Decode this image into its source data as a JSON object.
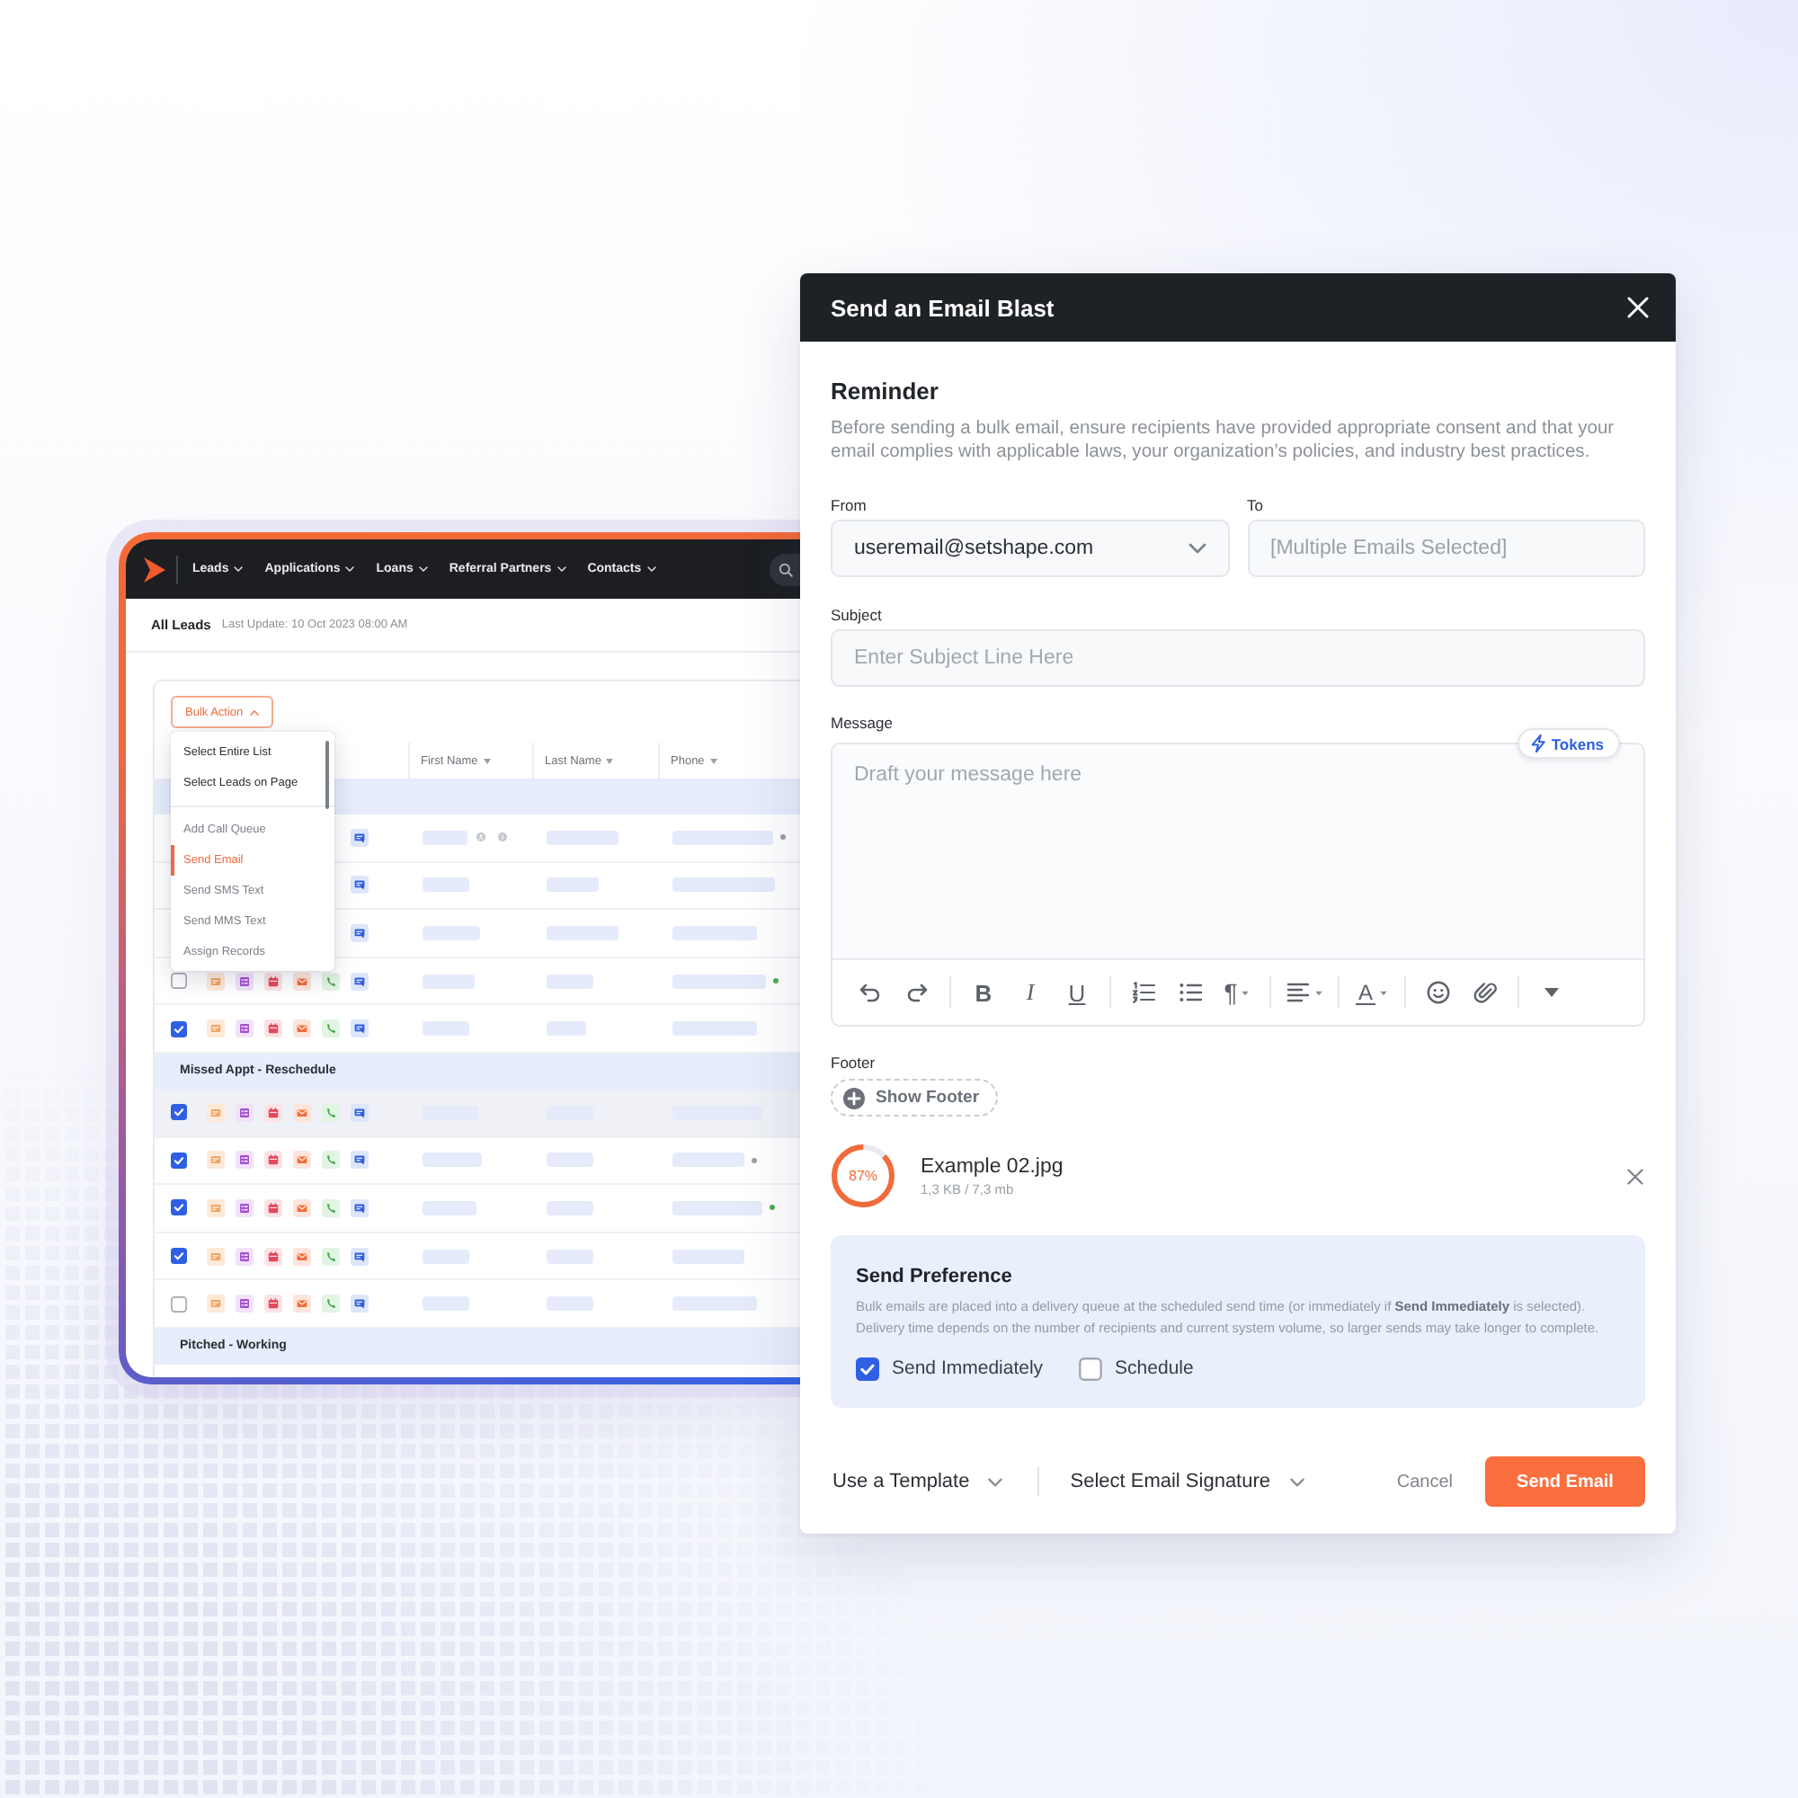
{
  "app": {
    "nav": {
      "items": [
        {
          "label": "Leads"
        },
        {
          "label": "Applications"
        },
        {
          "label": "Loans"
        },
        {
          "label": "Referral Partners"
        },
        {
          "label": "Contacts"
        }
      ]
    },
    "header": {
      "title": "All Leads",
      "last_update": "Last Update: 10 Oct 2023 08:00 AM"
    },
    "bulk_action": {
      "label": "Bulk Action",
      "expanded": true
    },
    "menu": {
      "sections": [
        {
          "kind": "selection",
          "items": [
            {
              "label": "Select Entire List",
              "selected": false
            },
            {
              "label": "Select Leads on Page",
              "selected": false
            }
          ]
        },
        {
          "kind": "action",
          "items": [
            {
              "label": "Add Call Queue",
              "selected": false
            },
            {
              "label": "Send Email",
              "selected": true
            },
            {
              "label": "Send SMS Text",
              "selected": false
            },
            {
              "label": "Send MMS Text",
              "selected": false
            },
            {
              "label": "Assign Records",
              "selected": false
            }
          ]
        }
      ]
    },
    "table": {
      "columns": [
        {
          "label": "First Name"
        },
        {
          "label": "Last Name"
        },
        {
          "label": "Phone"
        }
      ],
      "groups": [
        {
          "rows": [
            {
              "highlighted": false,
              "actions": [
                {
                  "kind": "chat"
                }
              ],
              "indicators": [
                {
                  "kind": "user"
                },
                {
                  "kind": "info"
                }
              ],
              "color": "#9aa0a6"
            },
            {
              "highlighted": false,
              "actions": [
                {
                  "kind": "chat"
                }
              ]
            },
            {
              "highlighted": false,
              "actions": [
                {
                  "kind": "chat"
                }
              ]
            },
            {
              "highlighted": false,
              "checked": false,
              "actions": [
                {
                  "kind": "note"
                },
                {
                  "kind": "list"
                },
                {
                  "kind": "calendar"
                },
                {
                  "kind": "mail"
                },
                {
                  "kind": "phone"
                },
                {
                  "kind": "chat"
                }
              ],
              "color": "#4caf50"
            },
            {
              "highlighted": false,
              "checked": true,
              "actions": [
                {
                  "kind": "note"
                },
                {
                  "kind": "list"
                },
                {
                  "kind": "calendar"
                },
                {
                  "kind": "mail"
                },
                {
                  "kind": "phone"
                },
                {
                  "kind": "chat"
                }
              ]
            }
          ]
        },
        {
          "label": "Missed Appt - Reschedule",
          "rows": [
            {
              "highlighted": true,
              "checked": true,
              "actions": [
                {
                  "kind": "note"
                },
                {
                  "kind": "list"
                },
                {
                  "kind": "calendar"
                },
                {
                  "kind": "mail"
                },
                {
                  "kind": "phone"
                },
                {
                  "kind": "chat"
                }
              ]
            },
            {
              "highlighted": false,
              "checked": true,
              "actions": [
                {
                  "kind": "note"
                },
                {
                  "kind": "list"
                },
                {
                  "kind": "calendar"
                },
                {
                  "kind": "mail"
                },
                {
                  "kind": "phone"
                },
                {
                  "kind": "chat"
                }
              ],
              "color": "#9aa0a6"
            },
            {
              "highlighted": false,
              "checked": true,
              "actions": [
                {
                  "kind": "note"
                },
                {
                  "kind": "list"
                },
                {
                  "kind": "calendar"
                },
                {
                  "kind": "mail"
                },
                {
                  "kind": "phone"
                },
                {
                  "kind": "chat"
                }
              ],
              "color": "#4caf50"
            },
            {
              "highlighted": false,
              "checked": true,
              "actions": [
                {
                  "kind": "note"
                },
                {
                  "kind": "list"
                },
                {
                  "kind": "calendar"
                },
                {
                  "kind": "mail"
                },
                {
                  "kind": "phone"
                },
                {
                  "kind": "chat"
                }
              ]
            },
            {
              "highlighted": false,
              "checked": false,
              "actions": [
                {
                  "kind": "note"
                },
                {
                  "kind": "list"
                },
                {
                  "kind": "calendar"
                },
                {
                  "kind": "mail"
                },
                {
                  "kind": "phone"
                },
                {
                  "kind": "chat"
                }
              ]
            }
          ]
        },
        {
          "label": "Pitched - Working"
        }
      ]
    }
  },
  "modal": {
    "title": "Send an Email Blast",
    "reminder": {
      "title": "Reminder",
      "text": "Before sending a bulk email, ensure recipients have provided appropriate consent and that your email complies with applicable laws, your organization’s policies, and industry best practices."
    },
    "from": {
      "label": "From",
      "value": "useremail@setshape.com"
    },
    "to": {
      "label": "To",
      "value": "[Multiple Emails Selected]",
      "disabled": true
    },
    "subject": {
      "label": "Subject",
      "placeholder": "Enter Subject Line Here"
    },
    "message": {
      "label": "Message",
      "placeholder": "Draft your message here",
      "tokens_button": "Tokens",
      "toolbar": [
        {
          "kind": "undo"
        },
        {
          "kind": "redo"
        },
        {
          "kind": "divider"
        },
        {
          "kind": "bold",
          "label": "B"
        },
        {
          "kind": "italic",
          "label": "I"
        },
        {
          "kind": "underline",
          "label": "U"
        },
        {
          "kind": "divider"
        },
        {
          "kind": "ordered_list"
        },
        {
          "kind": "bullet_list"
        },
        {
          "kind": "paragraph",
          "label": "¶",
          "dropdown": true
        },
        {
          "kind": "divider"
        },
        {
          "kind": "align",
          "dropdown": true
        },
        {
          "kind": "divider"
        },
        {
          "kind": "text_color",
          "label": "A",
          "dropdown": true
        },
        {
          "kind": "divider"
        },
        {
          "kind": "emoji"
        },
        {
          "kind": "attach"
        },
        {
          "kind": "divider"
        },
        {
          "kind": "more"
        }
      ]
    },
    "footer": {
      "label": "Footer",
      "button": "Show Footer"
    },
    "attachment": {
      "percent": "87%",
      "level": 0.87,
      "name": "Example 02.jpg",
      "size": "1,3 KB / 7,3 mb"
    },
    "send_preference": {
      "title": "Send Preference",
      "text": "Bulk emails are placed into a delivery queue at the scheduled send time (or immediately if **Send Immediately** is selected). Delivery time depends on the number of recipients and current system volume, so larger sends may take longer to complete.",
      "options": [
        {
          "label": "Send Immediately",
          "checked": true
        },
        {
          "label": "Schedule",
          "checked": false
        }
      ]
    },
    "actions": {
      "template": "Use a Template",
      "signature": "Select Email Signature",
      "cancel": "Cancel",
      "submit": "Send Email"
    }
  }
}
